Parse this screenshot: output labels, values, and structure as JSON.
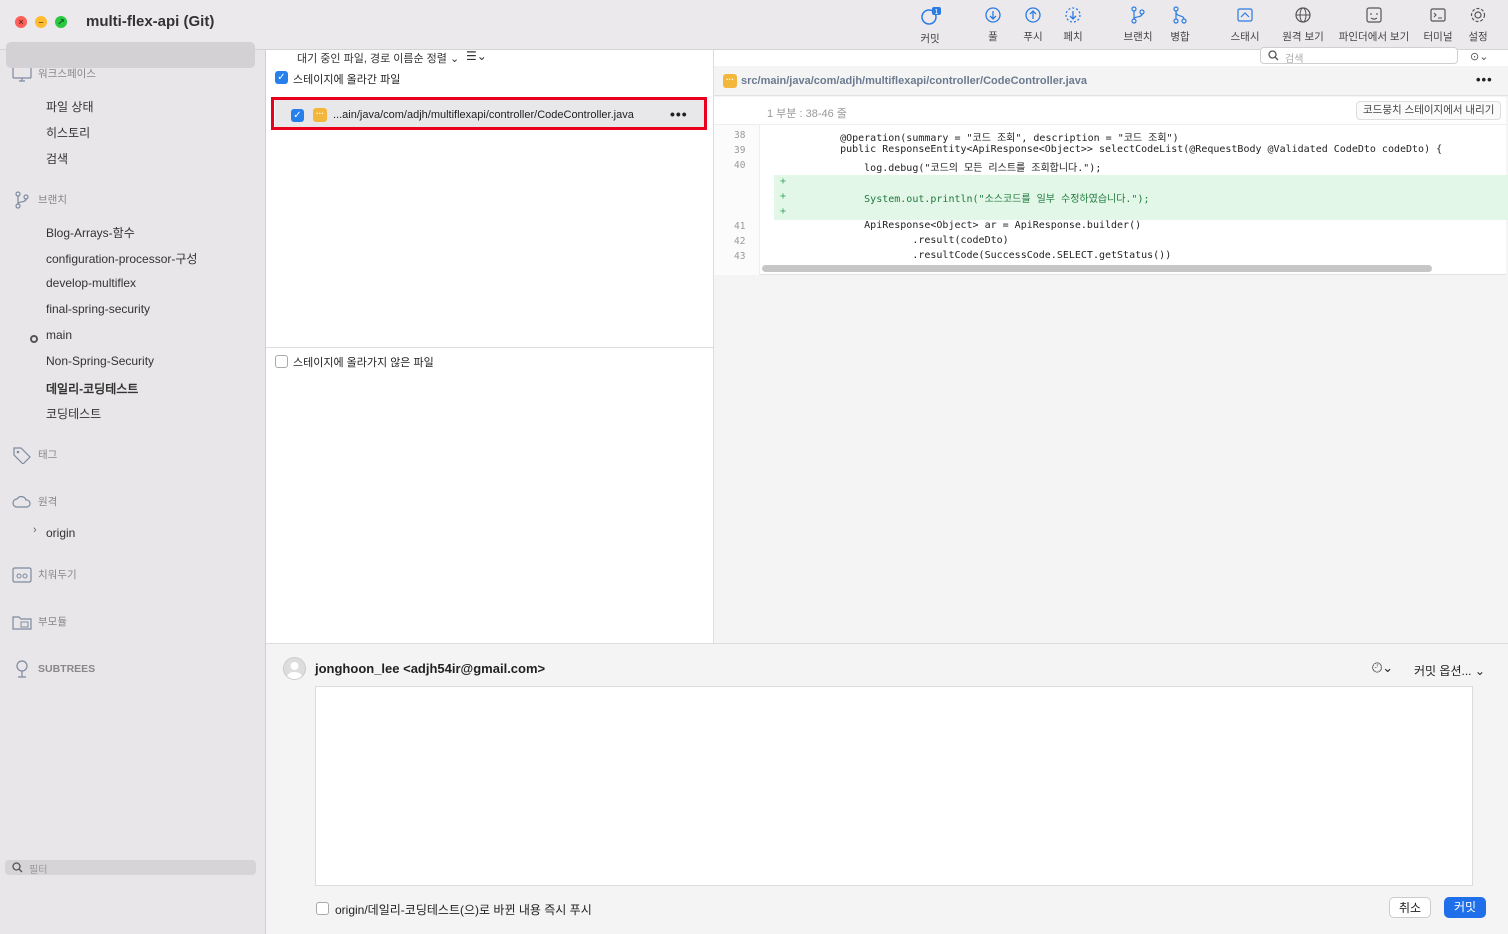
{
  "window": {
    "title": "multi-flex-api (Git)"
  },
  "toolbar": {
    "commit": "커밋",
    "commit_badge": "1",
    "pull": "풀",
    "push": "푸시",
    "fetch": "페치",
    "branch": "브랜치",
    "merge": "병합",
    "stash": "스태시",
    "remote": "원격 보기",
    "finder": "파인더에서 보기",
    "terminal": "터미널",
    "settings": "설정",
    "search_placeholder": "검색"
  },
  "sidebar": {
    "workspace": "워크스페이스",
    "workspace_items": [
      "파일 상태",
      "히스토리",
      "검색"
    ],
    "branches": "브랜치",
    "branch_items": [
      "Blog-Arrays-함수",
      "configuration-processor-구성",
      "develop-multiflex",
      "final-spring-security",
      "main",
      "Non-Spring-Security",
      "데일리-코딩테스트",
      "코딩테스트"
    ],
    "tags": "태그",
    "remotes": "원격",
    "remote_items": [
      "origin"
    ],
    "stashes": "치워두기",
    "submodules": "부모듈",
    "subtrees": "SUBTREES",
    "filter_placeholder": "필터"
  },
  "files": {
    "sort_label": "대기 중인 파일, 경로 이름순 정렬",
    "staged_header": "스테이지에 올라간 파일",
    "staged_files": [
      "...ain/java/com/adjh/multiflexapi/controller/CodeController.java"
    ],
    "unstaged_header": "스테이지에 올라가지 않은 파일"
  },
  "diff": {
    "path": "src/main/java/com/adjh/multiflexapi/controller/CodeController.java",
    "hunk_label": "1 부분 : 38-46 줄",
    "unstage_hunk": "코드뭉치 스테이지에서 내리기",
    "lines": [
      {
        "num": "38",
        "text": "    @Operation(summary = \"코드 조회\", description = \"코드 조회\")"
      },
      {
        "num": "39",
        "text": "    public ResponseEntity<ApiResponse<Object>> selectCodeList(@RequestBody @Validated CodeDto codeDto) {"
      },
      {
        "num": "40",
        "text": "        log.debug(\"코드의 모든 리스트를 조회합니다.\");"
      },
      {
        "num": "+",
        "text": ""
      },
      {
        "num": "+",
        "text": "        System.out.println(\"소스코드를 일부 수정하였습니다.\");"
      },
      {
        "num": "+",
        "text": ""
      },
      {
        "num": "41",
        "text": "        ApiResponse<Object> ar = ApiResponse.builder()"
      },
      {
        "num": "42",
        "text": "                .result(codeDto)"
      },
      {
        "num": "43",
        "text": "                .resultCode(SuccessCode.SELECT.getStatus())"
      }
    ]
  },
  "commit": {
    "author": "jonghoon_lee <adjh54ir@gmail.com>",
    "options": "커밋 옵션...",
    "push_option": "origin/데일리-코딩테스트(으)로 바뀐 내용 즉시 푸시",
    "cancel": "취소",
    "submit": "커밋"
  }
}
